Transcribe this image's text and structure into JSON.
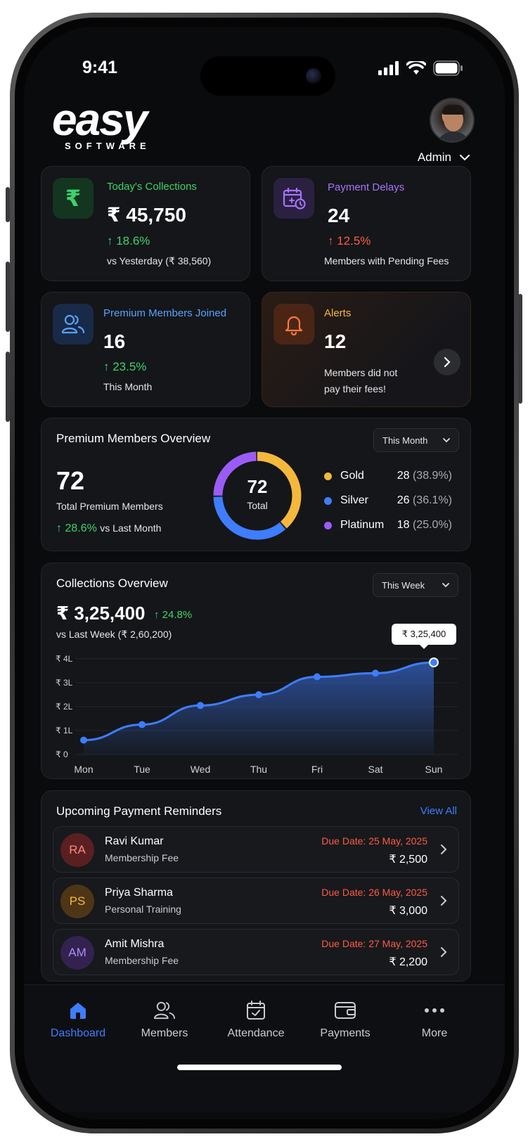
{
  "status_bar": {
    "time": "9:41"
  },
  "brand": {
    "logo_main": "easy",
    "logo_sub": "SOFTWARE"
  },
  "user": {
    "role": "Admin"
  },
  "stats": {
    "collections": {
      "title": "Today's Collections",
      "value": "₹ 45,750",
      "change": "↑ 18.6%",
      "sub": "vs Yesterday (₹ 38,560)"
    },
    "delays": {
      "title": "Payment Delays",
      "value": "24",
      "change": "↑ 12.5%",
      "sub": "Members with Pending Fees"
    },
    "premium": {
      "title": "Premium Members Joined",
      "value": "16",
      "change": "↑ 23.5%",
      "sub": "This Month"
    },
    "alerts": {
      "title": "Alerts",
      "value": "12",
      "sub_line1": "Members did not",
      "sub_line2": "pay their fees!"
    }
  },
  "overview": {
    "title": "Premium Members Overview",
    "period": "This Month",
    "total": "72",
    "total_label": "Total Premium Members",
    "change": "↑ 28.6%",
    "change_label": "vs Last Month",
    "donut_value": "72",
    "donut_label": "Total",
    "segments": [
      {
        "name": "Gold",
        "count": "28",
        "pct": "(38.9%)",
        "value": 28,
        "color": "#f5b83d"
      },
      {
        "name": "Silver",
        "count": "26",
        "pct": "(36.1%)",
        "value": 26,
        "color": "#3f7dff"
      },
      {
        "name": "Platinum",
        "count": "18",
        "pct": "(25.0%)",
        "value": 18,
        "color": "#9b5cf6"
      }
    ]
  },
  "collections_overview": {
    "title": "Collections Overview",
    "period": "This Week",
    "total": "₹ 3,25,400",
    "change": "↑ 24.8%",
    "compare": "vs Last Week (₹ 2,60,200)",
    "tooltip": "₹ 3,25,400"
  },
  "chart_data": {
    "type": "area",
    "categories": [
      "Mon",
      "Tue",
      "Wed",
      "Thu",
      "Fri",
      "Sat",
      "Sun"
    ],
    "values": [
      60000,
      125000,
      205000,
      250000,
      325000,
      340000,
      385000
    ],
    "y_ticks": [
      "₹ 0",
      "₹ 1L",
      "₹ 2L",
      "₹ 3L",
      "₹ 4L"
    ],
    "ylim": [
      0,
      400000
    ],
    "color": "#3f7dff"
  },
  "reminders": {
    "title": "Upcoming Payment Reminders",
    "view_all": "View All",
    "items": [
      {
        "initials": "RA",
        "name": "Ravi Kumar",
        "type": "Membership Fee",
        "due": "Due Date: 25 May, 2025",
        "amount": "₹ 2,500"
      },
      {
        "initials": "PS",
        "name": "Priya Sharma",
        "type": "Personal Training",
        "due": "Due Date: 26 May, 2025",
        "amount": "₹ 3,000"
      },
      {
        "initials": "AM",
        "name": "Amit Mishra",
        "type": "Membership Fee",
        "due": "Due Date: 27 May, 2025",
        "amount": "₹ 2,200"
      }
    ]
  },
  "nav": {
    "dashboard": "Dashboard",
    "members": "Members",
    "attendance": "Attendance",
    "payments": "Payments",
    "more": "More"
  }
}
